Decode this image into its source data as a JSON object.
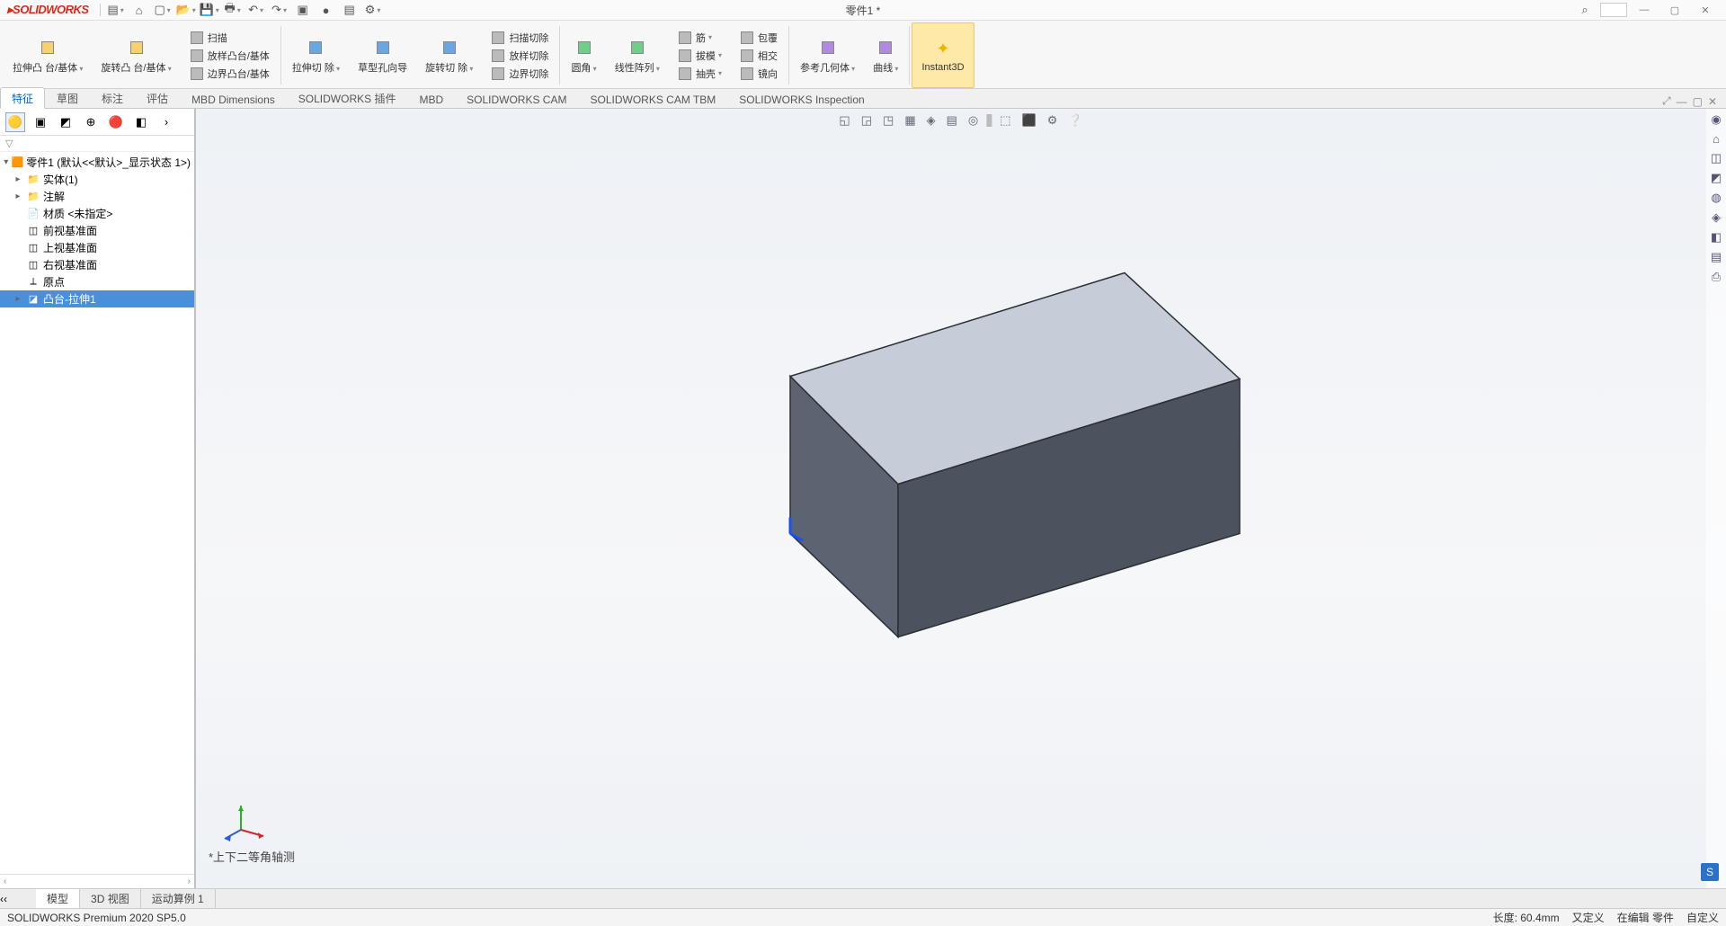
{
  "app": {
    "name": "SOLIDWORKS",
    "doc_title": "零件1 *"
  },
  "titlebar_search_icon": "⌕",
  "ribbon": {
    "groups": [
      {
        "big": {
          "label": "拉伸凸\n台/基体",
          "icon_color": "cyellow"
        }
      },
      {
        "big": {
          "label": "旋转凸\n台/基体",
          "icon_color": "cyellow"
        }
      },
      {
        "col": [
          {
            "label": "扫描",
            "icon_color": "cgray"
          },
          {
            "label": "放样凸台/基体",
            "icon_color": "cgray"
          },
          {
            "label": "边界凸台/基体",
            "icon_color": "cgray"
          }
        ]
      },
      {
        "big": {
          "label": "拉伸切\n除",
          "icon_color": "cblue"
        }
      },
      {
        "big": {
          "label": "草型孔向导",
          "icon_color": "cblue"
        }
      },
      {
        "big": {
          "label": "旋转切\n除",
          "icon_color": "cblue"
        }
      },
      {
        "col": [
          {
            "label": "扫描切除",
            "icon_color": "cgray"
          },
          {
            "label": "放样切除",
            "icon_color": "cgray"
          },
          {
            "label": "边界切除",
            "icon_color": "cgray"
          }
        ]
      },
      {
        "big": {
          "label": "圆角",
          "icon_color": "cgreen"
        }
      },
      {
        "big": {
          "label": "线性阵列",
          "icon_color": "cgreen"
        }
      },
      {
        "col": [
          {
            "label": "筋",
            "icon_color": "cgray"
          },
          {
            "label": "拔模",
            "icon_color": "cgray"
          },
          {
            "label": "抽壳",
            "icon_color": "cgray"
          }
        ]
      },
      {
        "col": [
          {
            "label": "包覆",
            "icon_color": "cgray"
          },
          {
            "label": "相交",
            "icon_color": "cgray"
          },
          {
            "label": "镜向",
            "icon_color": "cgray"
          }
        ]
      },
      {
        "big": {
          "label": "参考几何体",
          "icon_color": "cpurple"
        }
      },
      {
        "big": {
          "label": "曲线",
          "icon_color": "cpurple"
        }
      },
      {
        "big_hl": {
          "label": "Instant3D",
          "icon_color": "cyellow"
        }
      }
    ]
  },
  "dock_tabs": [
    "特征",
    "草图",
    "标注",
    "评估",
    "MBD Dimensions",
    "SOLIDWORKS 插件",
    "MBD",
    "SOLIDWORKS CAM",
    "SOLIDWORKS CAM TBM",
    "SOLIDWORKS Inspection"
  ],
  "dock_active_index": 0,
  "tree": {
    "root": "零件1 (默认<<默认>_显示状态 1>)",
    "nodes": [
      {
        "label": "实体(1)",
        "icon": "📁",
        "tw": "▸"
      },
      {
        "label": "注解",
        "icon": "📁",
        "tw": "▸"
      },
      {
        "label": "材质 <未指定>",
        "icon": "📄",
        "tw": ""
      },
      {
        "label": "前视基准面",
        "icon": "◫",
        "tw": ""
      },
      {
        "label": "上视基准面",
        "icon": "◫",
        "tw": ""
      },
      {
        "label": "右视基准面",
        "icon": "◫",
        "tw": ""
      },
      {
        "label": "原点",
        "icon": "⟂",
        "tw": ""
      },
      {
        "label": "凸台-拉伸1",
        "icon": "◪",
        "tw": "▸",
        "sel": true
      }
    ]
  },
  "hud_icons": [
    "◱",
    "◲",
    "◳",
    "▦",
    "◈",
    "▤",
    "◎",
    "·",
    "⬚",
    "⬛",
    "⚙",
    "❔"
  ],
  "right_strip": [
    "◉",
    "⌂",
    "◫",
    "◩",
    "◍",
    "◈",
    "◧",
    "▤",
    "⎙"
  ],
  "view_label": "*上下二等角轴测",
  "bottom_tabs": [
    "模型",
    "3D 视图",
    "运动算例 1"
  ],
  "bottom_active_index": 0,
  "status": {
    "left": "SOLIDWORKS Premium 2020 SP5.0",
    "length": "长度: 60.4mm",
    "custom": "又定义",
    "editing": "在编辑 零件",
    "cust2": "自定义"
  }
}
